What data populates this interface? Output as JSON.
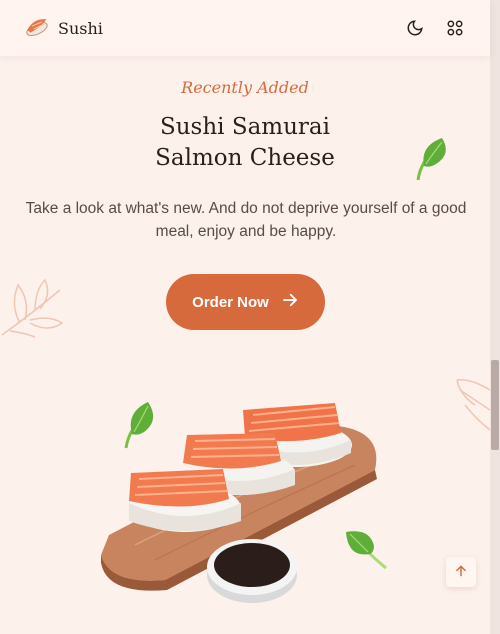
{
  "header": {
    "logo_text": "Sushi",
    "logo_icon": "sushi-logo-icon",
    "theme_icon": "moon-icon",
    "menu_icon": "grid-menu-icon"
  },
  "hero": {
    "subtitle": "Recently Added",
    "title_line1": "Sushi Samurai",
    "title_line2": "Salmon Cheese",
    "description": "Take a look at what's new. And do not deprive yourself of a good meal, enjoy and be happy.",
    "button_label": "Order Now",
    "button_icon": "arrow-right-icon"
  },
  "scroll_up_icon": "arrow-up-icon",
  "colors": {
    "background": "#fdf1ec",
    "accent": "#d66a3c",
    "title": "#2b1f1c",
    "leaf": "#5fae3a"
  }
}
